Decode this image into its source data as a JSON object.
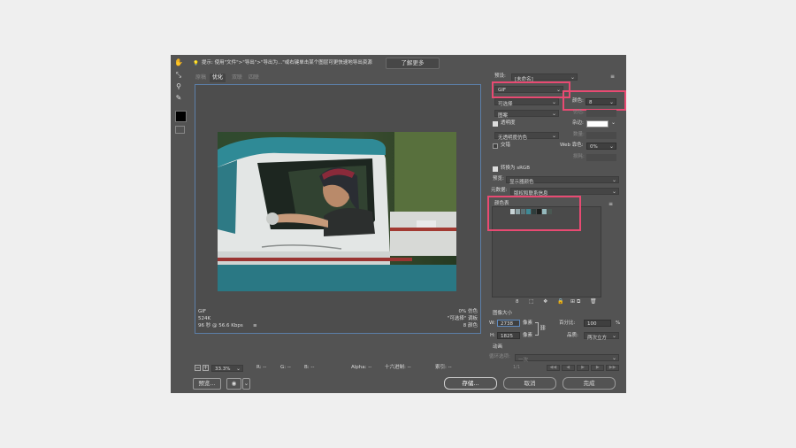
{
  "hint": {
    "text": "提示: 使用\"文件\">\"导出\">\"导出为...\"或右键单击某个图层可更快速地导出资源",
    "learn_more": "了解更多"
  },
  "view_tabs": [
    "原稿",
    "优化",
    "双联",
    "四联"
  ],
  "preset": {
    "label": "预设:",
    "value": "[未命名]"
  },
  "format": {
    "value": "GIF"
  },
  "reduction": {
    "value": "可选择"
  },
  "colors": {
    "label": "颜色:",
    "value": "8"
  },
  "dither_algo": {
    "value": "图案"
  },
  "dither": {
    "label": "仿色:",
    "value": ""
  },
  "transparency": {
    "label": "透明度",
    "matte_label": "杂边:"
  },
  "transparency_dither": {
    "value": "无透明度仿色",
    "amount_label": "数量:"
  },
  "interlaced": {
    "label": "交错",
    "web_snap_label": "Web 靠色:",
    "web_snap_value": "0%",
    "lossy_label": "损耗:"
  },
  "convert_srgb": {
    "label": "转换为 sRGB"
  },
  "preview": {
    "label": "预览:",
    "value": "显示器颜色"
  },
  "metadata": {
    "label": "元数据:",
    "value": "版权和联系信息"
  },
  "color_table": {
    "title": "颜色表",
    "count": "8",
    "swatches": [
      "#c8d3d6",
      "#8da3a7",
      "#5d7377",
      "#3f8a96",
      "#2f3d3c",
      "#1c1f1d",
      "#95b9bd",
      "#4a5852"
    ]
  },
  "image_size": {
    "title": "图像大小",
    "w_label": "W:",
    "w_value": "2738",
    "h_label": "H:",
    "h_value": "1825",
    "unit": "像素",
    "percent_label": "百分比:",
    "percent_value": "100",
    "percent_unit": "%",
    "quality_label": "品质:",
    "quality_value": "两次立方"
  },
  "animation": {
    "title": "动画",
    "loop_label": "循环选项:",
    "loop_value": "一次",
    "frame": "1/1"
  },
  "image_info": {
    "format": "GIF",
    "size": "524K",
    "time": "96 秒 @ 56.6 Kbps",
    "dither_pct": "0% 仿色",
    "palette": "\"可选择\" 调板",
    "colors": "8 颜色"
  },
  "status": {
    "zoom": "33.3%",
    "r": "R: --",
    "g": "G: --",
    "b": "B: --",
    "alpha": "Alpha: --",
    "hex": "十六进制: --",
    "index": "索引: --"
  },
  "buttons": {
    "preview": "预览...",
    "save": "存储...",
    "cancel": "取消",
    "done": "完成"
  },
  "menu_icon": "≡"
}
